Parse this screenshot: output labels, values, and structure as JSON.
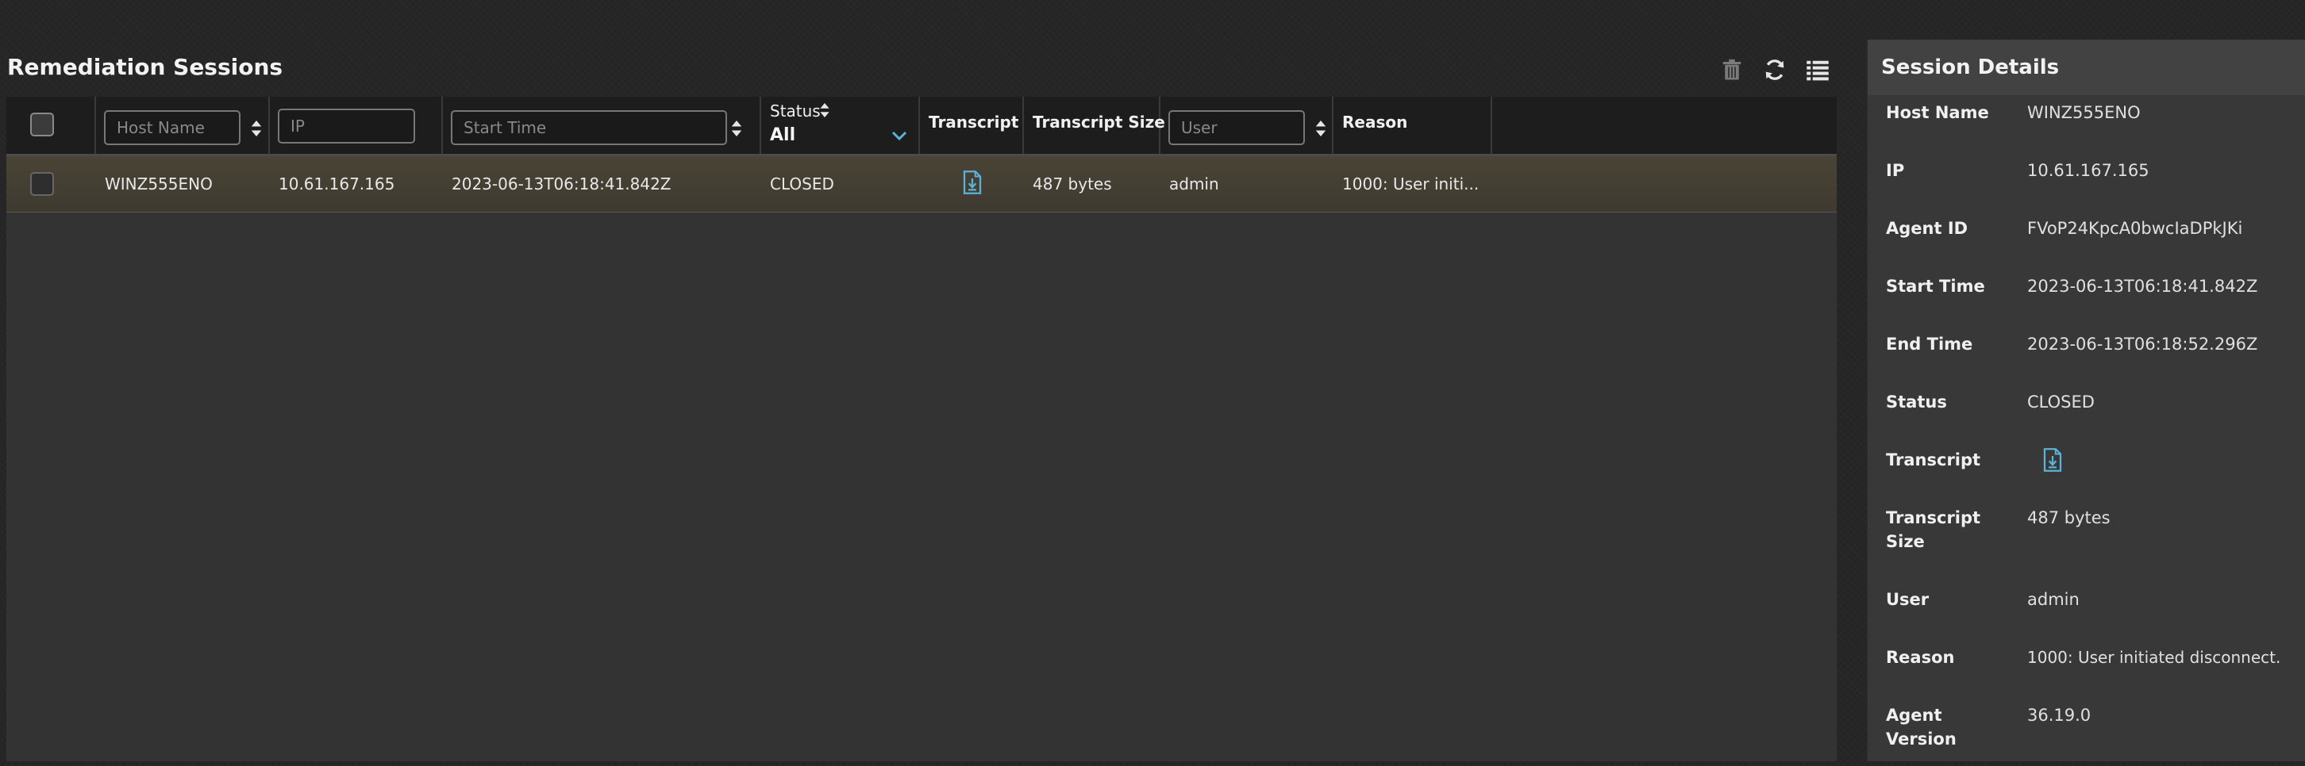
{
  "page": {
    "title": "Remediation Sessions"
  },
  "toolbar": {
    "delete_icon": "trash-icon",
    "refresh_icon": "refresh-icon",
    "columns_icon": "list-icon"
  },
  "grid": {
    "columns": {
      "host_name": {
        "placeholder": "Host Name"
      },
      "ip": {
        "placeholder": "IP"
      },
      "start_time": {
        "placeholder": "Start Time"
      },
      "status": {
        "label": "Status",
        "selected": "All"
      },
      "transcript": {
        "label": "Transcript"
      },
      "transcript_size": {
        "label": "Transcript Size"
      },
      "user": {
        "placeholder": "User"
      },
      "reason": {
        "label": "Reason"
      }
    },
    "rows": [
      {
        "host_name": "WINZ555ENO",
        "ip": "10.61.167.165",
        "start_time": "2023-06-13T06:18:41.842Z",
        "status": "CLOSED",
        "transcript_icon": "file-download-icon",
        "transcript_size": "487 bytes",
        "user": "admin",
        "reason": "1000: User initi..."
      }
    ]
  },
  "details": {
    "title": "Session Details",
    "fields": [
      {
        "label": "Host Name",
        "value": "WINZ555ENO"
      },
      {
        "label": "IP",
        "value": "10.61.167.165"
      },
      {
        "label": "Agent ID",
        "value": "FVoP24KpcA0bwcIaDPkJKi"
      },
      {
        "label": "Start Time",
        "value": "2023-06-13T06:18:41.842Z"
      },
      {
        "label": "End Time",
        "value": "2023-06-13T06:18:52.296Z"
      },
      {
        "label": "Status",
        "value": "CLOSED"
      },
      {
        "label": "Transcript",
        "value": ""
      },
      {
        "label": "Transcript Size",
        "value": "487 bytes"
      },
      {
        "label": "User",
        "value": "admin"
      },
      {
        "label": "Reason",
        "value": "1000: User initiated disconnect."
      },
      {
        "label": "Agent Version",
        "value": "36.19.0"
      }
    ]
  },
  "colors": {
    "accent": "#5bb3d9",
    "selected_row": "#4a4436"
  }
}
